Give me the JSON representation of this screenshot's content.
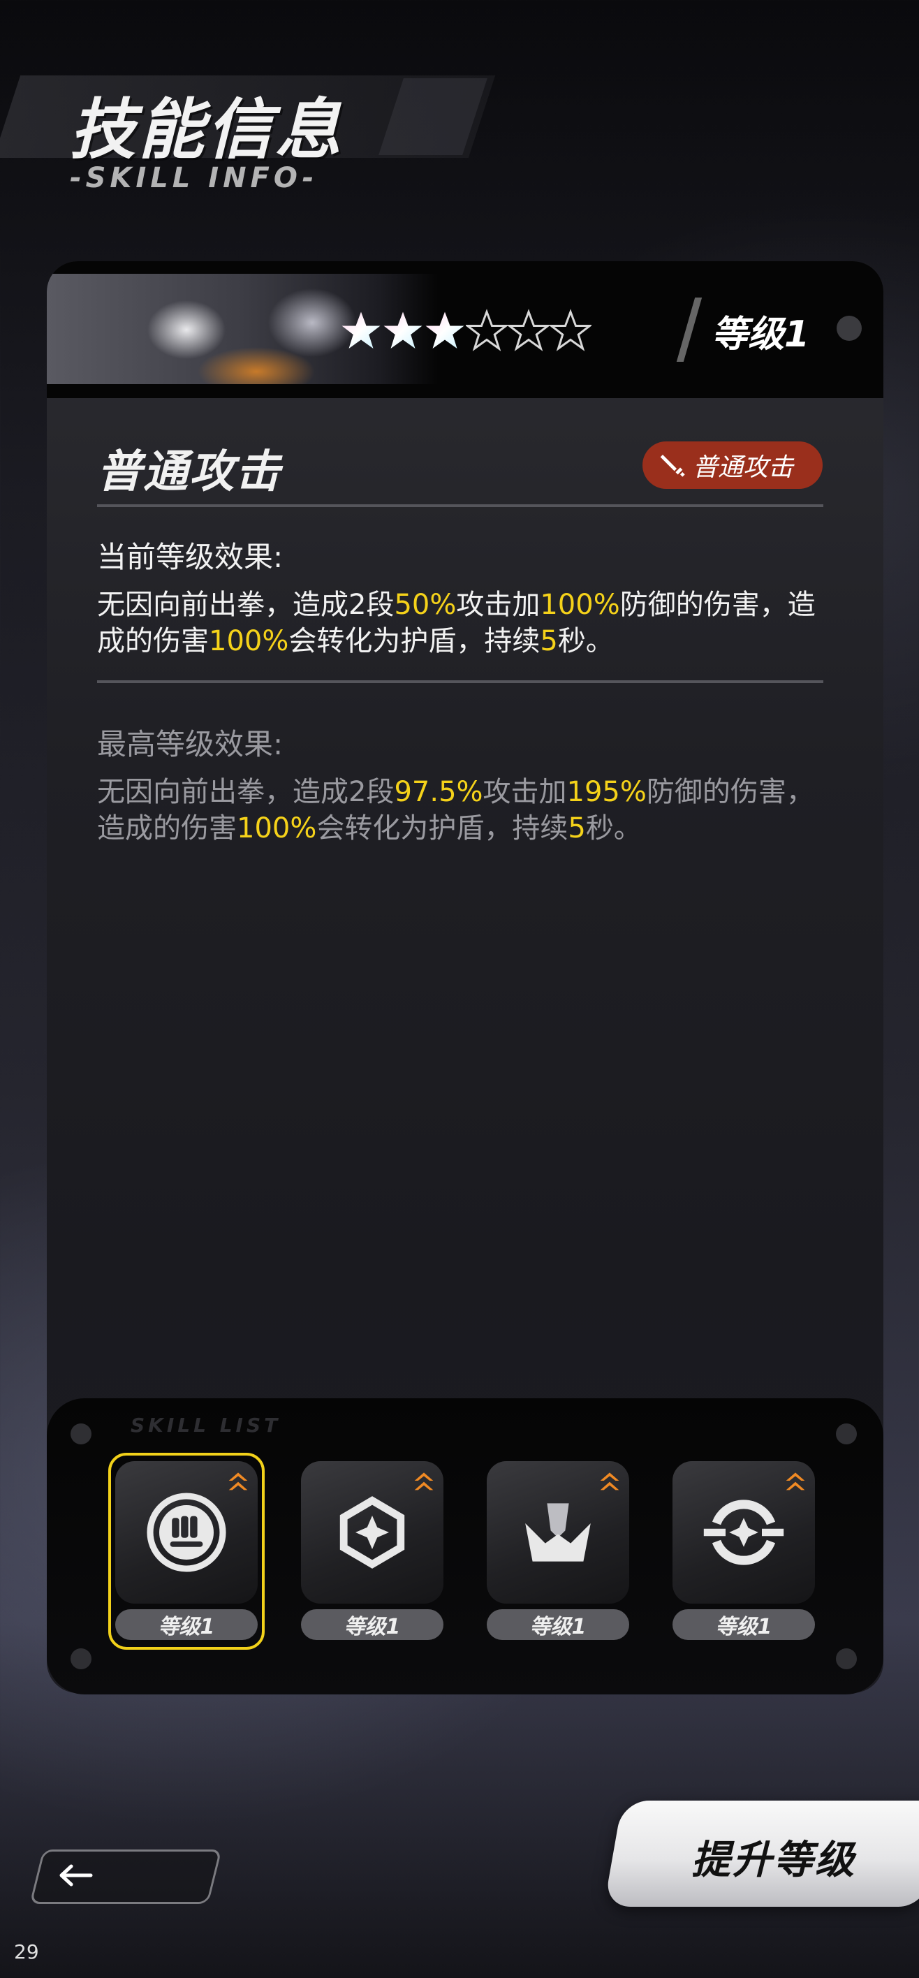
{
  "header": {
    "title": "技能信息",
    "subtitle": "-SKILL INFO-"
  },
  "skill_card": {
    "stars": {
      "filled": 3,
      "total": 6
    },
    "level_label": "等级1",
    "skill_name": "普通攻击",
    "skill_type_badge": "普通攻击",
    "current_effect": {
      "heading": "当前等级效果:",
      "parts": [
        "无因向前出拳，造成2段",
        "50%",
        "攻击加",
        "100%",
        "防御的伤害，造成的伤害",
        "100%",
        "会转化为护盾，持续",
        "5",
        "秒。"
      ]
    },
    "max_effect": {
      "heading": "最高等级效果:",
      "parts": [
        "无因向前出拳，造成2段",
        "97.5%",
        "攻击加",
        "195%",
        "防御的伤害，造成的伤害",
        "100%",
        "会转化为护盾，持续",
        "5",
        "秒。"
      ]
    }
  },
  "skill_tray": {
    "label": "SKILL LIST",
    "skills": [
      {
        "icon": "fist-icon",
        "level": "等级1",
        "selected": true
      },
      {
        "icon": "cube-star-icon",
        "level": "等级1",
        "selected": false
      },
      {
        "icon": "burst-icon",
        "level": "等级1",
        "selected": false
      },
      {
        "icon": "crosshair-icon",
        "level": "等级1",
        "selected": false
      }
    ]
  },
  "footer": {
    "upgrade_button": "提升等级",
    "page_number": "29"
  },
  "colors": {
    "highlight": "#f5d21a",
    "badge": "#9a2f1c",
    "selection": "#f2d11a",
    "upgrade_arrow": "#f08a24"
  }
}
